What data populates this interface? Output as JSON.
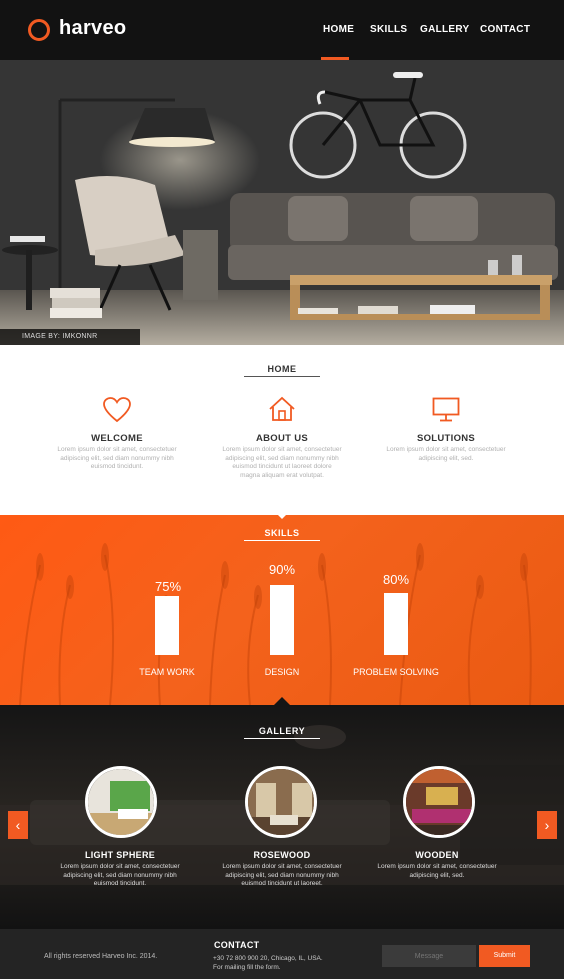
{
  "brand": {
    "name": "harveo",
    "accent": "#f15a22"
  },
  "nav": {
    "items": [
      {
        "label": "HOME",
        "active": true
      },
      {
        "label": "SKILLS"
      },
      {
        "label": "GALLERY"
      },
      {
        "label": "CONTACT"
      }
    ]
  },
  "hero": {
    "credit": "IMAGE BY: IMKONNR"
  },
  "home": {
    "title": "HOME",
    "features": [
      {
        "icon": "heart-icon",
        "title": "WELCOME",
        "text": "Lorem ipsum dolor sit amet, consectetuer adipiscing elit, sed diam nonummy nibh euismod tincidunt."
      },
      {
        "icon": "house-icon",
        "title": "ABOUT US",
        "text": "Lorem ipsum dolor sit amet, consectetuer adipiscing elit, sed diam nonummy nibh euismod tincidunt ut laoreet dolore magna aliquam erat volutpat."
      },
      {
        "icon": "monitor-icon",
        "title": "SOLUTIONS",
        "text": "Lorem ipsum dolor sit amet, consectetuer adipiscing elit, sed."
      }
    ]
  },
  "skills": {
    "title": "SKILLS",
    "items": [
      {
        "label": "TEAM WORK",
        "percent": "75%",
        "value": 75
      },
      {
        "label": "DESIGN",
        "percent": "90%",
        "value": 90
      },
      {
        "label": "PROBLEM SOLVING",
        "percent": "80%",
        "value": 80
      }
    ]
  },
  "gallery": {
    "title": "GALLERY",
    "items": [
      {
        "title": "LIGHT SPHERE",
        "text": "Lorem ipsum dolor sit amet, consectetuer adipiscing elit, sed diam nonummy nibh euismod tincidunt."
      },
      {
        "title": "ROSEWOOD",
        "text": "Lorem ipsum dolor sit amet, consectetuer adipiscing elit, sed diam nonummy nibh euismod tincidunt ut laoreet."
      },
      {
        "title": "WOODEN",
        "text": "Lorem ipsum dolor sit amet, consectetuer adipiscing elit, sed."
      }
    ],
    "prev": "‹",
    "next": "›"
  },
  "footer": {
    "copyright": "All rights reserved Harveo Inc. 2014.",
    "contact_title": "CONTACT",
    "address_line1": "+30 72 800 900 20, Chicago, IL, USA.",
    "address_line2": "For mailing fill the form.",
    "message_placeholder": "Message",
    "submit_label": "Submit"
  }
}
